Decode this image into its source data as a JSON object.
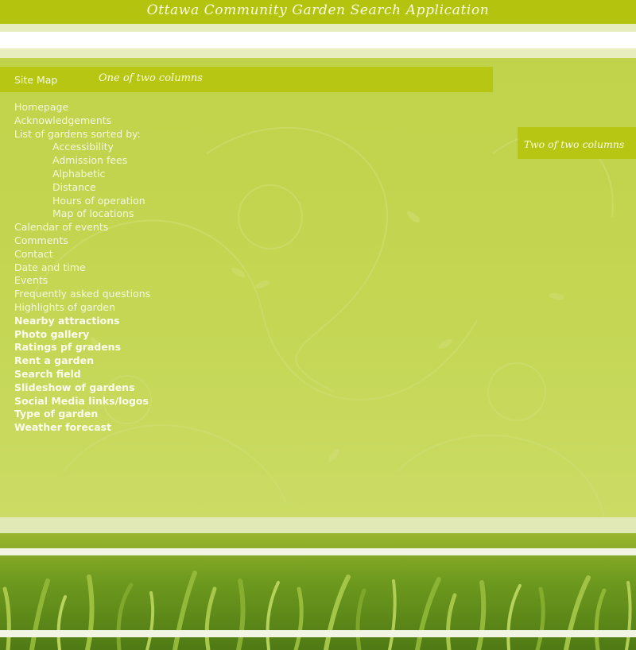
{
  "header": {
    "title": "Ottawa Community Garden Search Application"
  },
  "column_one": {
    "sitemap_label": "Site Map",
    "column_label": "One of two columns"
  },
  "column_two": {
    "column_label": "Two of two columns"
  },
  "sitemap": {
    "items": [
      {
        "label": "Homepage",
        "level": 0,
        "bold": false
      },
      {
        "label": "Acknowledgements",
        "level": 0,
        "bold": false
      },
      {
        "label": "List of gardens sorted by:",
        "level": 0,
        "bold": false
      },
      {
        "label": "Accessibility",
        "level": 1,
        "bold": false
      },
      {
        "label": "Admission fees",
        "level": 1,
        "bold": false
      },
      {
        "label": "Alphabetic",
        "level": 1,
        "bold": false
      },
      {
        "label": "Distance",
        "level": 1,
        "bold": false
      },
      {
        "label": "Hours of operation",
        "level": 1,
        "bold": false
      },
      {
        "label": "Map of locations",
        "level": 1,
        "bold": false
      },
      {
        "label": "Calendar of events",
        "level": 0,
        "bold": false
      },
      {
        "label": "Comments",
        "level": 0,
        "bold": false
      },
      {
        "label": "Contact",
        "level": 0,
        "bold": false
      },
      {
        "label": "Date and time",
        "level": 0,
        "bold": false
      },
      {
        "label": "Events",
        "level": 0,
        "bold": false
      },
      {
        "label": "Frequently asked questions",
        "level": 0,
        "bold": false
      },
      {
        "label": "Highlights of garden",
        "level": 0,
        "bold": false
      },
      {
        "label": "Nearby attractions",
        "level": 0,
        "bold": true
      },
      {
        "label": "Photo gallery",
        "level": 0,
        "bold": true
      },
      {
        "label": "Ratings pf gradens",
        "level": 0,
        "bold": true
      },
      {
        "label": "Rent a garden",
        "level": 0,
        "bold": true
      },
      {
        "label": "Search field",
        "level": 0,
        "bold": true
      },
      {
        "label": "Slideshow of gardens",
        "level": 0,
        "bold": true
      },
      {
        "label": "Social Media links/logos",
        "level": 0,
        "bold": true
      },
      {
        "label": "Type of garden",
        "level": 0,
        "bold": true
      },
      {
        "label": "Weather forecast",
        "level": 0,
        "bold": true
      }
    ]
  },
  "colors": {
    "title_bar": "#b4c40e",
    "background": "#c2d24a",
    "column_bar": "#b6c612",
    "stripe": "#e7edbc",
    "text": "#f4f8dc"
  },
  "footer_image": "grass-photo"
}
